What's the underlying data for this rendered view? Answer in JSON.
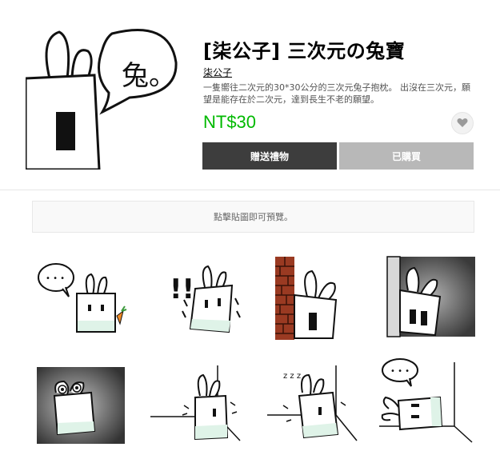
{
  "product": {
    "title": "[柒公子] 三次元の兔寶",
    "author": "柒公子",
    "description": "一隻嚮往二次元的30*30公分的三次元兔子抱枕。 出沒在三次元，願望是能存在於二次元，達到長生不老的願望。",
    "price": "NT$30",
    "main_bubble_text": "兔。"
  },
  "buttons": {
    "gift_label": "贈送禮物",
    "bought_label": "已購買"
  },
  "preview": {
    "hint": "點擊貼圖即可預覽。"
  },
  "stickers": [
    {
      "name": "sticker-speech-bubble-carrot",
      "bubble": "• • •"
    },
    {
      "name": "sticker-exclaim-shaking",
      "bubble": "!!"
    },
    {
      "name": "sticker-peek-brick-wall",
      "bubble": ""
    },
    {
      "name": "sticker-peek-dark-wall",
      "bubble": ""
    },
    {
      "name": "sticker-dark-corner-scared",
      "bubble": ""
    },
    {
      "name": "sticker-corner-crying",
      "bubble": ""
    },
    {
      "name": "sticker-corner-sleeping",
      "bubble": "z z z"
    },
    {
      "name": "sticker-lying-speech-bubble",
      "bubble": "• • •"
    }
  ],
  "colors": {
    "price_green": "#00b900",
    "gift_button": "#3d3d3d",
    "bought_button": "#b8b8b8",
    "bunny_base_mint": "#dff3e8",
    "brick": "#9a3a22"
  }
}
